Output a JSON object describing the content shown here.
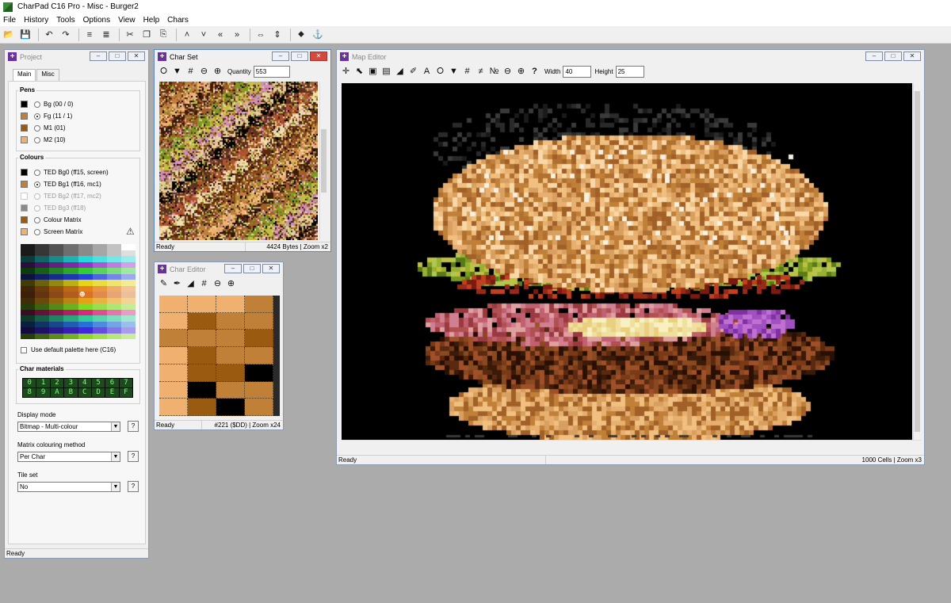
{
  "app": {
    "title": "CharPad C16 Pro - Misc - Burger2"
  },
  "menu": [
    "File",
    "History",
    "Tools",
    "Options",
    "View",
    "Help",
    "Chars"
  ],
  "toolbar": {
    "icons": [
      "open-icon",
      "save-icon",
      "undo-icon",
      "redo-icon",
      "align-icon",
      "spring-icon",
      "cut-icon",
      "copy-icon",
      "paste-icon",
      "up-icon",
      "down-icon",
      "left-icon",
      "right-icon",
      "flip-h-icon",
      "flip-v-icon",
      "split-icon",
      "anchor-icon"
    ]
  },
  "project": {
    "title": "Project",
    "tabs": [
      "Main",
      "Misc"
    ],
    "pens_label": "Pens",
    "pens": [
      {
        "label": "Bg (00 / 0)",
        "color": "#000000",
        "checked": false
      },
      {
        "label": "Fg (11 / 1)",
        "color": "#c08038",
        "checked": true
      },
      {
        "label": "M1 (01)",
        "color": "#9a5a10",
        "checked": false
      },
      {
        "label": "M2 (10)",
        "color": "#f0b070",
        "checked": false
      }
    ],
    "colours_label": "Colours",
    "colours": [
      {
        "label": "TED Bg0 (ff15, screen)",
        "color": "#000000",
        "checked": false,
        "dim": false
      },
      {
        "label": "TED Bg1 (ff16, mc1)",
        "color": "#c08038",
        "checked": true,
        "dim": false
      },
      {
        "label": "TED Bg2 (ff17, mc2)",
        "color": "#ffffff",
        "checked": false,
        "dim": true
      },
      {
        "label": "TED Bg3 (ff18)",
        "color": "#8a8a8a",
        "checked": false,
        "dim": true
      },
      {
        "label": "Colour Matrix",
        "color": "#9a5a10",
        "checked": false,
        "dim": false
      },
      {
        "label": "Screen Matrix",
        "color": "#f0b070",
        "checked": false,
        "dim": false
      }
    ],
    "default_palette_label": "Use default palette here (C16)",
    "char_materials_label": "Char materials",
    "materials": [
      "0",
      "1",
      "2",
      "3",
      "4",
      "5",
      "6",
      "7",
      "8",
      "9",
      "A",
      "B",
      "C",
      "D",
      "E",
      "F"
    ],
    "display_mode_label": "Display mode",
    "display_mode": "Bitmap - Multi-colour",
    "matrix_label": "Matrix colouring method",
    "matrix_value": "Per Char",
    "tileset_label": "Tile set",
    "tileset_value": "No",
    "help_label": "?",
    "status": "Ready"
  },
  "charset": {
    "title": "Char Set",
    "quantity_label": "Quantity",
    "quantity": "553",
    "status_left": "Ready",
    "status_right": "4424 Bytes | Zoom x2"
  },
  "chareditor": {
    "title": "Char Editor",
    "status_left": "Ready",
    "status_right": "#221 ($DD) | Zoom x24",
    "pixels": [
      [
        "#f0b070",
        "#f0b070",
        "#f0b070",
        "#c08038"
      ],
      [
        "#f0b070",
        "#9a5a10",
        "#c08038",
        "#c08038"
      ],
      [
        "#c08038",
        "#c08038",
        "#c08038",
        "#9a5a10"
      ],
      [
        "#f0b070",
        "#9a5a10",
        "#c08038",
        "#c08038"
      ],
      [
        "#f0b070",
        "#9a5a10",
        "#9a5a10",
        "#000000"
      ],
      [
        "#f0b070",
        "#000000",
        "#c08038",
        "#c08038"
      ],
      [
        "#f0b070",
        "#9a5a10",
        "#000000",
        "#c08038"
      ]
    ]
  },
  "mapeditor": {
    "title": "Map Editor",
    "width_label": "Width",
    "width": "40",
    "height_label": "Height",
    "height": "25",
    "help_label": "?",
    "status_left": "Ready",
    "status_right": "1000 Cells | Zoom x3"
  }
}
